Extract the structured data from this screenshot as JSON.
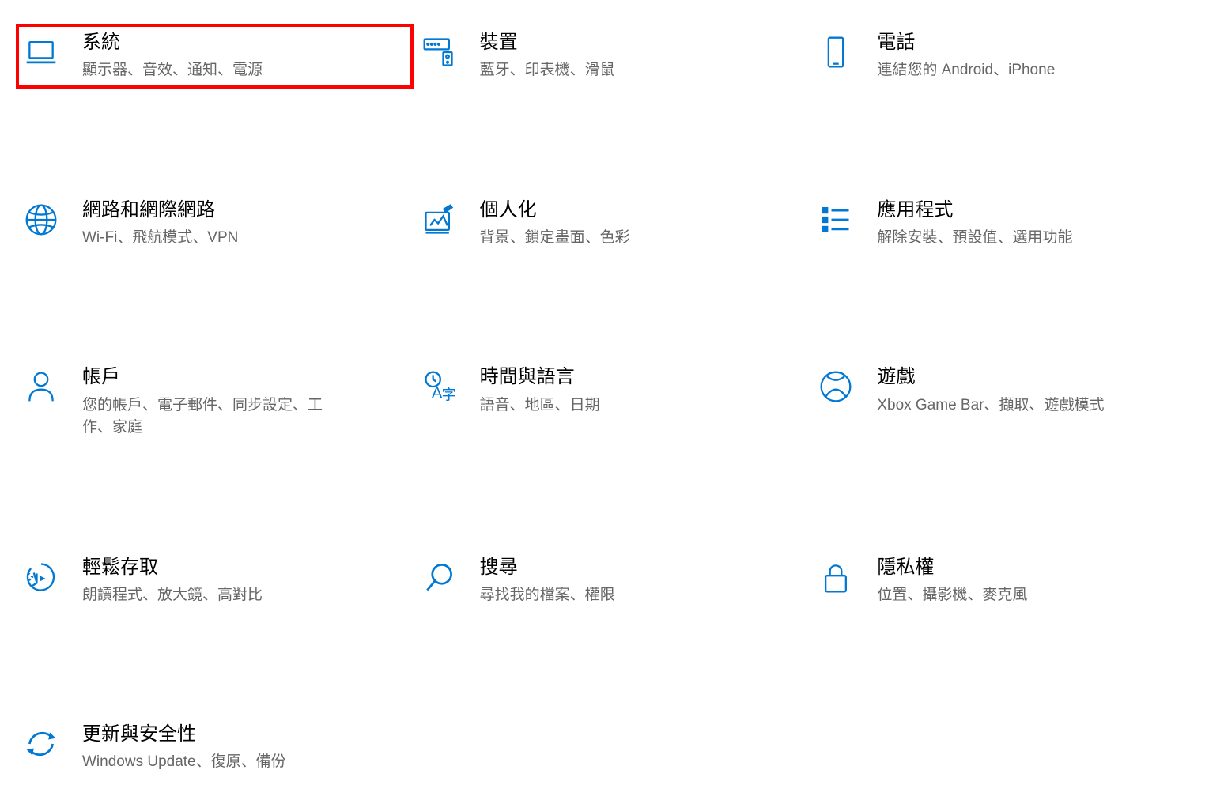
{
  "colors": {
    "icon": "#0078d4",
    "title": "#000000",
    "subtitle": "#666666",
    "highlight": "#ff0000"
  },
  "settings": {
    "system": {
      "title": "系統",
      "subtitle": "顯示器、音效、通知、電源",
      "icon": "laptop-icon",
      "highlighted": true
    },
    "devices": {
      "title": "裝置",
      "subtitle": "藍牙、印表機、滑鼠",
      "icon": "devices-icon"
    },
    "phone": {
      "title": "電話",
      "subtitle": "連結您的 Android、iPhone",
      "icon": "phone-icon"
    },
    "network": {
      "title": "網路和網際網路",
      "subtitle": "Wi-Fi、飛航模式、VPN",
      "icon": "globe-icon"
    },
    "personalization": {
      "title": "個人化",
      "subtitle": "背景、鎖定畫面、色彩",
      "icon": "personalization-icon"
    },
    "apps": {
      "title": "應用程式",
      "subtitle": "解除安裝、預設值、選用功能",
      "icon": "apps-list-icon"
    },
    "accounts": {
      "title": "帳戶",
      "subtitle": "您的帳戶、電子郵件、同步設定、工作、家庭",
      "icon": "person-icon"
    },
    "time_language": {
      "title": "時間與語言",
      "subtitle": "語音、地區、日期",
      "icon": "time-language-icon"
    },
    "gaming": {
      "title": "遊戲",
      "subtitle": "Xbox Game Bar、擷取、遊戲模式",
      "icon": "xbox-icon"
    },
    "ease_of_access": {
      "title": "輕鬆存取",
      "subtitle": "朗讀程式、放大鏡、高對比",
      "icon": "ease-of-access-icon"
    },
    "search": {
      "title": "搜尋",
      "subtitle": "尋找我的檔案、權限",
      "icon": "search-icon"
    },
    "privacy": {
      "title": "隱私權",
      "subtitle": "位置、攝影機、麥克風",
      "icon": "lock-icon"
    },
    "update_security": {
      "title": "更新與安全性",
      "subtitle": "Windows Update、復原、備份",
      "icon": "sync-icon"
    }
  }
}
